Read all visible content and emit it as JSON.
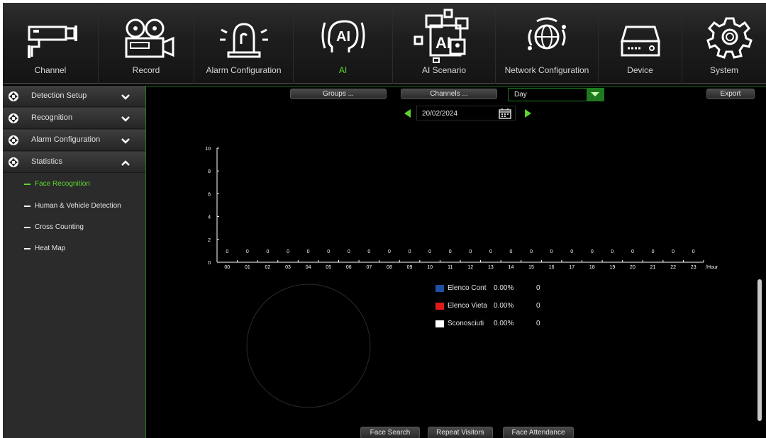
{
  "nav": {
    "items": [
      {
        "label": "Channel",
        "icon": "camera-icon",
        "active": false
      },
      {
        "label": "Record",
        "icon": "video-recorder-icon",
        "active": false
      },
      {
        "label": "Alarm Configuration",
        "icon": "alarm-beacon-icon",
        "active": false
      },
      {
        "label": "AI",
        "icon": "ai-head-icon",
        "active": true
      },
      {
        "label": "AI Scenario",
        "icon": "ai-scenario-icon",
        "active": false
      },
      {
        "label": "Network Configuration",
        "icon": "globe-icon",
        "active": false
      },
      {
        "label": "Device",
        "icon": "storage-device-icon",
        "active": false
      },
      {
        "label": "System",
        "icon": "gear-icon",
        "active": false
      }
    ]
  },
  "sidebar": {
    "groups": [
      {
        "label": "Detection Setup",
        "expanded": false
      },
      {
        "label": "Recognition",
        "expanded": false
      },
      {
        "label": "Alarm Configuration",
        "expanded": false
      },
      {
        "label": "Statistics",
        "expanded": true
      }
    ],
    "statistics_items": [
      {
        "label": "Face Recognition",
        "active": true
      },
      {
        "label": "Human & Vehicle Detection",
        "active": false
      },
      {
        "label": "Cross Counting",
        "active": false
      },
      {
        "label": "Heat Map",
        "active": false
      }
    ]
  },
  "toolbar": {
    "groups_label": "Groups ...",
    "channels_label": "Channels ...",
    "period_value": "Day",
    "export_label": "Export"
  },
  "date_nav": {
    "date": "20/02/2024"
  },
  "chart_data": {
    "type": "bar",
    "categories": [
      "00",
      "01",
      "02",
      "03",
      "04",
      "05",
      "06",
      "07",
      "08",
      "09",
      "10",
      "11",
      "12",
      "13",
      "14",
      "15",
      "16",
      "17",
      "18",
      "19",
      "20",
      "21",
      "22",
      "23"
    ],
    "values": [
      0,
      0,
      0,
      0,
      0,
      0,
      0,
      0,
      0,
      0,
      0,
      0,
      0,
      0,
      0,
      0,
      0,
      0,
      0,
      0,
      0,
      0,
      0,
      0
    ],
    "ylim": [
      0,
      10
    ],
    "yticks": [
      0,
      2,
      4,
      6,
      8,
      10
    ],
    "x_unit": "/Hour"
  },
  "legend": [
    {
      "name": "Elenco Cont",
      "color": "#1e4fa0",
      "percent": "0.00%",
      "count": "0"
    },
    {
      "name": "Elenco Vieta",
      "color": "#e01a1a",
      "percent": "0.00%",
      "count": "0"
    },
    {
      "name": "Sconosciuti",
      "color": "#ffffff",
      "percent": "0.00%",
      "count": "0"
    }
  ],
  "bottom_buttons": {
    "face_search": "Face Search",
    "repeat_visitors": "Repeat Visitors",
    "face_attendance": "Face Attendance"
  },
  "colors": {
    "accent": "#5ed630",
    "frame": "#1f7a1f"
  }
}
